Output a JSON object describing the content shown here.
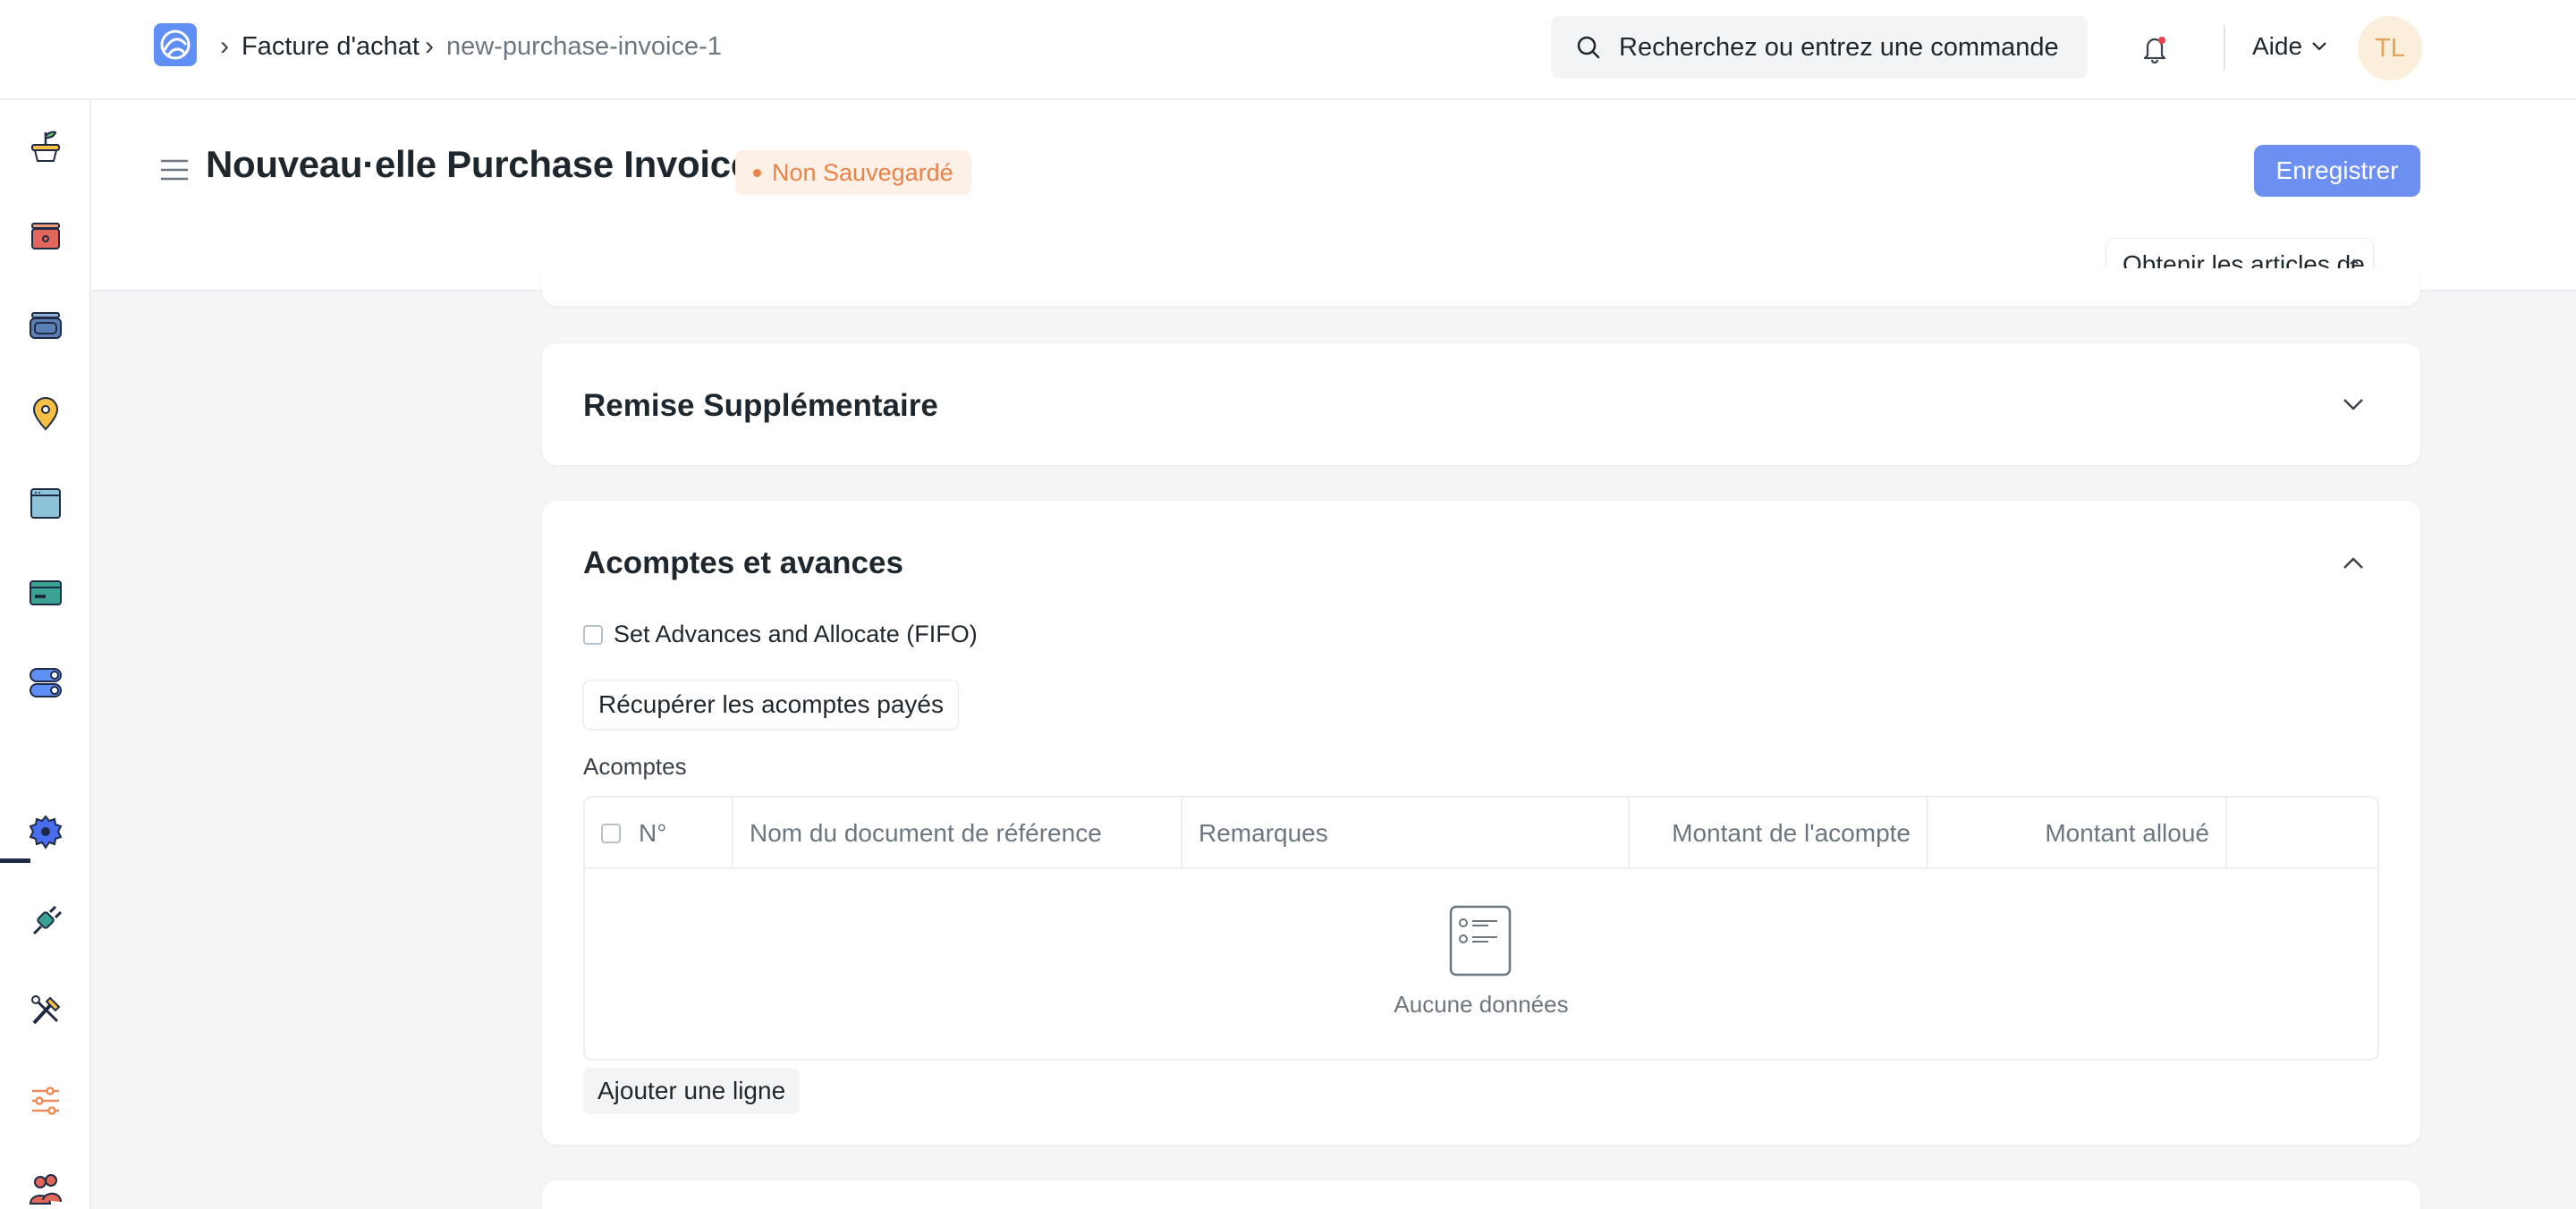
{
  "breadcrumbs": [
    "Facture d'achat",
    "new-purchase-invoice-1"
  ],
  "search": {
    "placeholder": "Recherchez ou entrez une commande"
  },
  "nav": {
    "help_label": "Aide",
    "avatar_initials": "TL"
  },
  "page": {
    "title": "Nouveau·elle Purchase Invoice",
    "status": "Non Sauvegardé",
    "save_label": "Enregistrer",
    "get_items_label": "Obtenir les articles de"
  },
  "sections": {
    "discount": {
      "title": "Remise Supplémentaire"
    },
    "advances": {
      "title": "Acomptes et avances",
      "checkbox_label": "Set Advances and Allocate (FIFO)",
      "fetch_button": "Récupérer les acomptes payés",
      "table_label": "Acomptes",
      "columns": [
        "N°",
        "Nom du document de référence",
        "Remarques",
        "Montant de l'acompte",
        "Montant alloué"
      ],
      "empty_text": "Aucune données",
      "add_row_label": "Ajouter une ligne"
    }
  },
  "colors": {
    "accent": "#6e8ff2",
    "status": "#e8834a"
  }
}
